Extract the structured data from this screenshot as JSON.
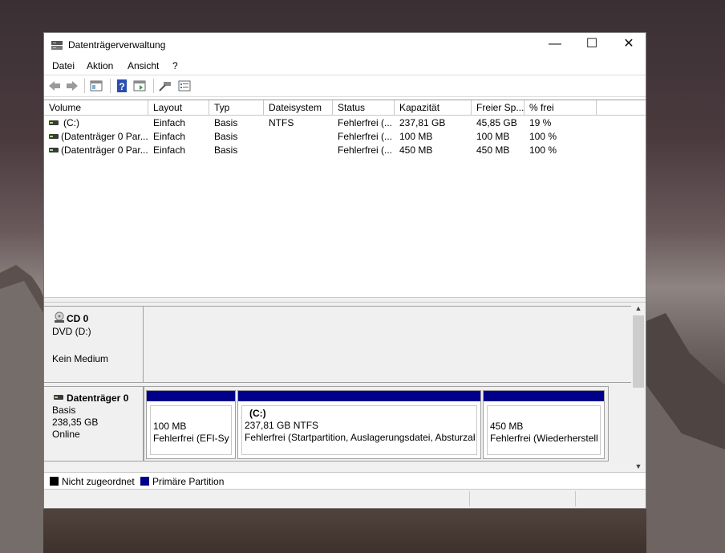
{
  "window": {
    "title": "Datenträgerverwaltung"
  },
  "window_controls": {
    "minimize": "—",
    "maximize": "☐",
    "close": "✕"
  },
  "menu": [
    "Datei",
    "Aktion",
    "Ansicht",
    "?"
  ],
  "volume_list": {
    "columns": [
      "Volume",
      "Layout",
      "Typ",
      "Dateisystem",
      "Status",
      "Kapazität",
      "Freier Sp...",
      "% frei"
    ],
    "rows": [
      [
        "(C:)",
        "Einfach",
        "Basis",
        "NTFS",
        "Fehlerfrei (...",
        "237,81 GB",
        "45,85 GB",
        "19 %"
      ],
      [
        "(Datenträger 0 Par...",
        "Einfach",
        "Basis",
        "",
        "Fehlerfrei (...",
        "100 MB",
        "100 MB",
        "100 %"
      ],
      [
        "(Datenträger 0 Par...",
        "Einfach",
        "Basis",
        "",
        "Fehlerfrei (...",
        "450 MB",
        "450 MB",
        "100 %"
      ]
    ]
  },
  "disks": {
    "cd": {
      "name": "CD 0",
      "line1": "DVD (D:)",
      "line2": "Kein Medium"
    },
    "disk0": {
      "name": "Datenträger 0",
      "line1": "Basis",
      "line2": "238,35 GB",
      "line3": "Online",
      "partitions": [
        {
          "title": "",
          "size": "100 MB",
          "status": "Fehlerfrei (EFI-Syst"
        },
        {
          "title": "(C:)",
          "size": "237,81 GB NTFS",
          "status": "Fehlerfrei (Startpartition, Auslagerungsdatei, Absturzabbild, Primäre Partition)"
        },
        {
          "title": "",
          "size": "450 MB",
          "status": "Fehlerfrei (Wiederherstellungspartition)"
        }
      ]
    }
  },
  "legend": {
    "unallocated": "Nicht zugeordnet",
    "primary": "Primäre Partition"
  },
  "colors": {
    "primary_partition": "#00008b",
    "unallocated": "#000000"
  },
  "icons": [
    "disk-management-icon",
    "back-arrow-icon",
    "forward-arrow-icon",
    "properties-icon",
    "help-icon",
    "view-icon",
    "connect-icon",
    "list-icon",
    "drive-icon",
    "cd-drive-icon"
  ]
}
